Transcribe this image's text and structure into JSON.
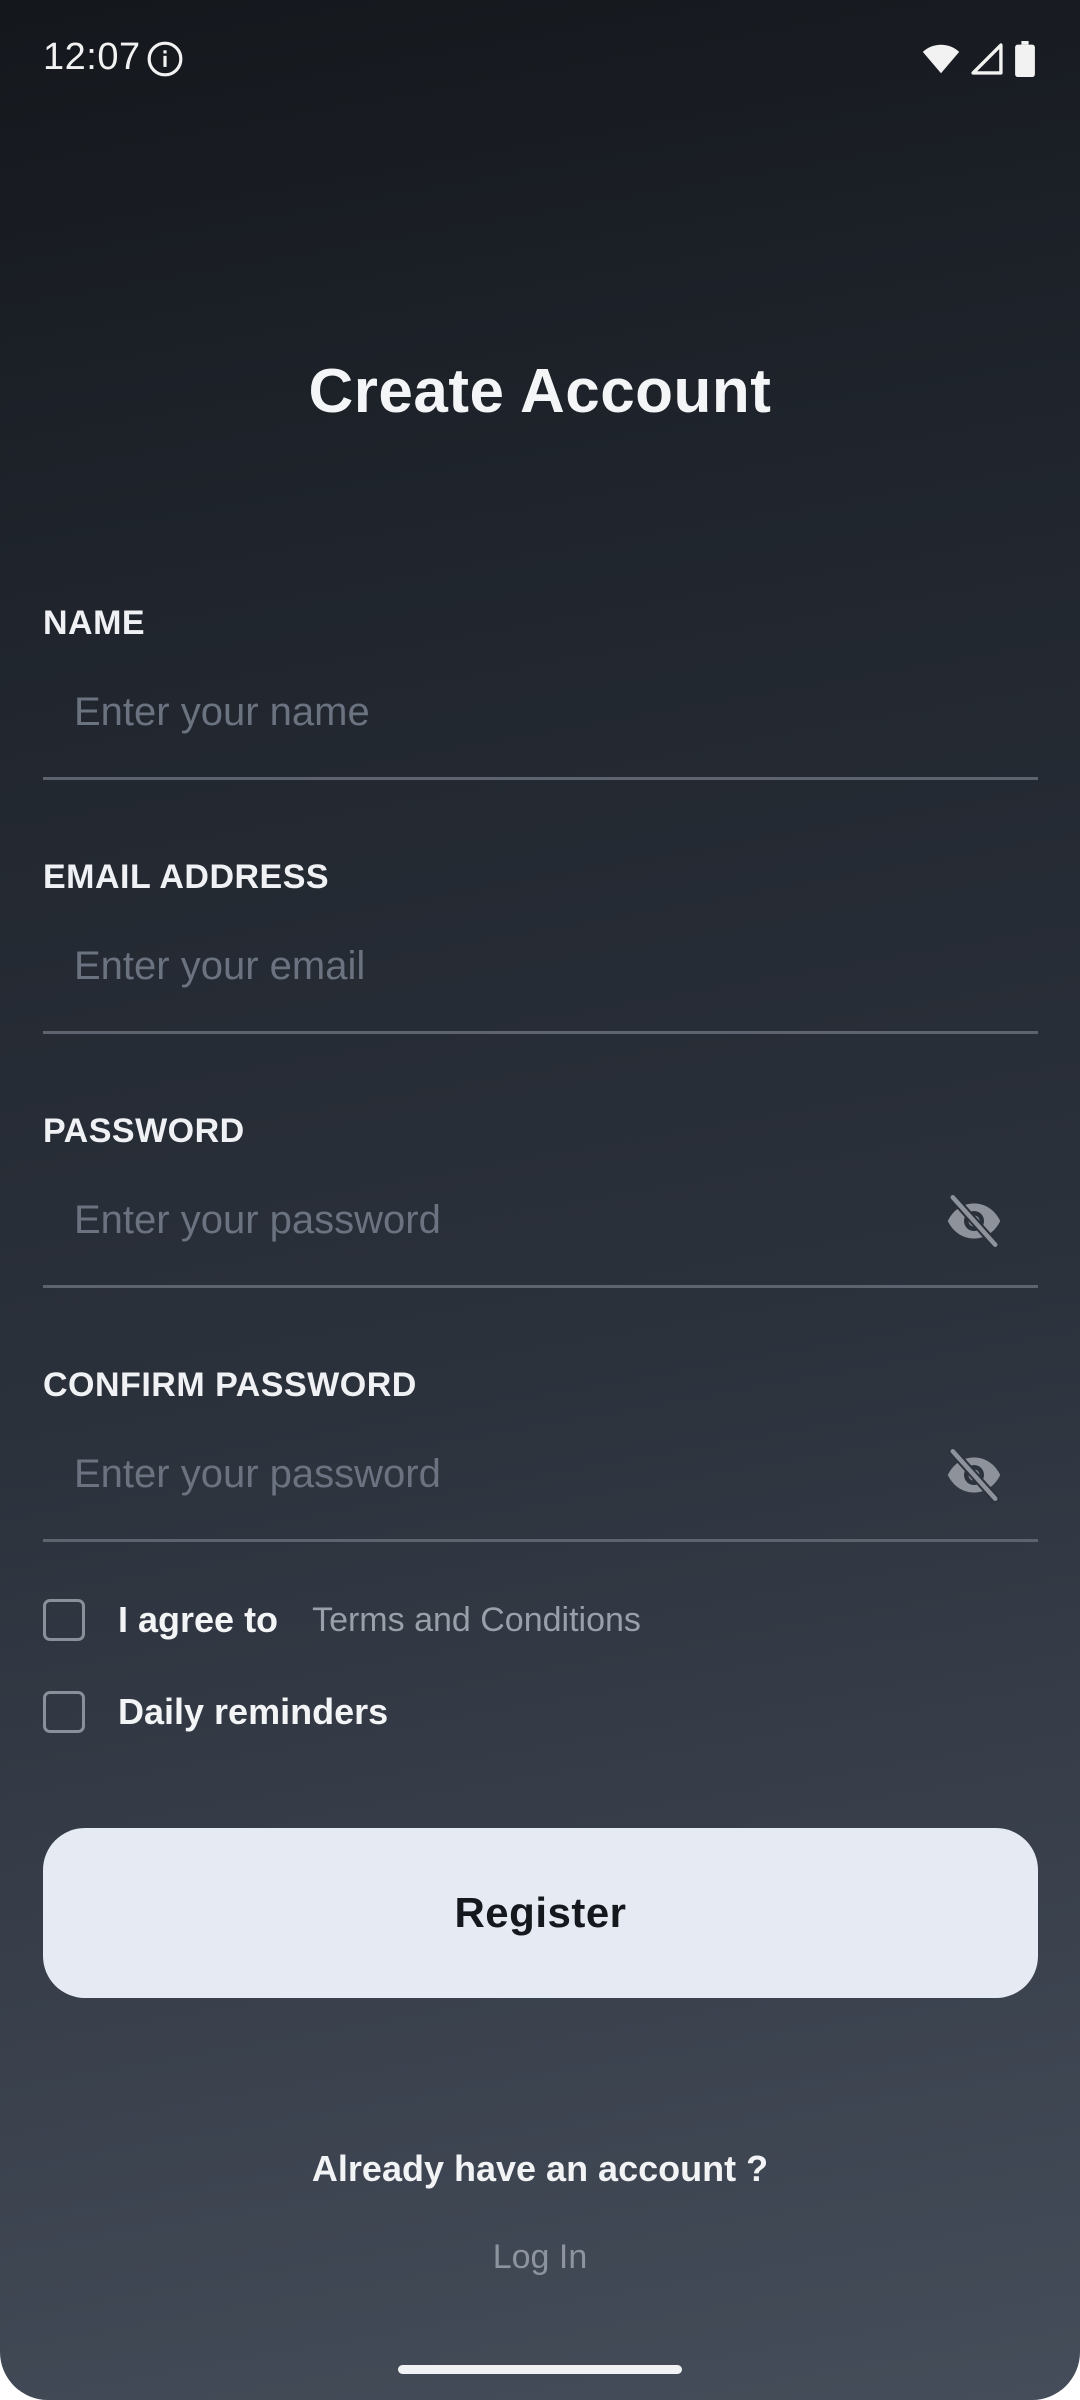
{
  "status_bar": {
    "time": "12:07",
    "icons": [
      "info-icon",
      "wifi-icon",
      "cellular-signal-icon",
      "battery-icon"
    ]
  },
  "page": {
    "title": "Create Account"
  },
  "form": {
    "name": {
      "label": "NAME",
      "placeholder": "Enter your name",
      "value": ""
    },
    "email": {
      "label": "EMAIL ADDRESS",
      "placeholder": "Enter your email",
      "value": ""
    },
    "password": {
      "label": "PASSWORD",
      "placeholder": "Enter your password",
      "value": "",
      "toggle_icon": "eye-off-icon"
    },
    "confirm_password": {
      "label": "CONFIRM PASSWORD",
      "placeholder": "Enter your password",
      "value": "",
      "toggle_icon": "eye-off-icon"
    },
    "agree": {
      "label": "I agree to",
      "link": "Terms and Conditions",
      "checked": false
    },
    "reminders": {
      "label": "Daily reminders",
      "checked": false
    },
    "register_label": "Register"
  },
  "footer": {
    "prompt": "Already have an account ?",
    "login_label": "Log In"
  },
  "colors": {
    "background_top": "#14171c",
    "background_bottom": "#454d5a",
    "button_bg": "#e6eaf3",
    "button_text": "#15181d",
    "placeholder": "#6b7280",
    "link": "#9aa0aa",
    "divider": "#5d6470"
  }
}
